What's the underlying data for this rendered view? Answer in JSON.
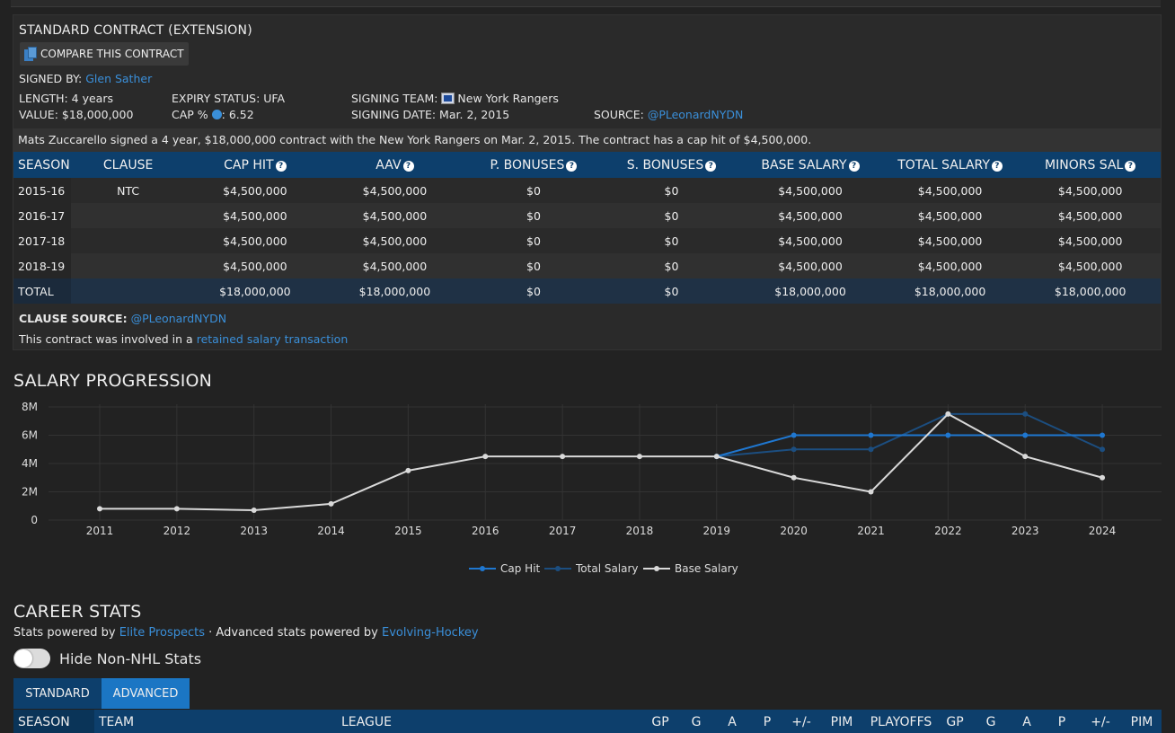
{
  "contract": {
    "title": "STANDARD CONTRACT (EXTENSION)",
    "compare_label": "COMPARE THIS CONTRACT",
    "signed_by_label": "SIGNED BY:",
    "signed_by": "Glen Sather",
    "length": "LENGTH: 4 years",
    "value": "VALUE: $18,000,000",
    "expiry_status": "EXPIRY STATUS: UFA",
    "cap_pct_label": "CAP %",
    "cap_pct_value": ": 6.52",
    "signing_team_label": "SIGNING TEAM:",
    "signing_team": "New York Rangers",
    "signing_date": "SIGNING DATE: Mar. 2, 2015",
    "source_label": "SOURCE:",
    "source": "@PLeonardNYDN",
    "summary": "Mats Zuccarello signed a 4 year, $18,000,000 contract with the New York Rangers on Mar. 2, 2015. The contract has a cap hit of $4,500,000.",
    "headers": [
      "SEASON",
      "CLAUSE",
      "CAP HIT",
      "AAV",
      "P. BONUSES",
      "S. BONUSES",
      "BASE SALARY",
      "TOTAL SALARY",
      "MINORS SAL"
    ],
    "rows": [
      [
        "2015-16",
        "NTC",
        "$4,500,000",
        "$4,500,000",
        "$0",
        "$0",
        "$4,500,000",
        "$4,500,000",
        "$4,500,000"
      ],
      [
        "2016-17",
        "",
        "$4,500,000",
        "$4,500,000",
        "$0",
        "$0",
        "$4,500,000",
        "$4,500,000",
        "$4,500,000"
      ],
      [
        "2017-18",
        "",
        "$4,500,000",
        "$4,500,000",
        "$0",
        "$0",
        "$4,500,000",
        "$4,500,000",
        "$4,500,000"
      ],
      [
        "2018-19",
        "",
        "$4,500,000",
        "$4,500,000",
        "$0",
        "$0",
        "$4,500,000",
        "$4,500,000",
        "$4,500,000"
      ]
    ],
    "total": [
      "TOTAL",
      "",
      "$18,000,000",
      "$18,000,000",
      "$0",
      "$0",
      "$18,000,000",
      "$18,000,000",
      "$18,000,000"
    ],
    "clause_source_label": "CLAUSE SOURCE:",
    "clause_source": "@PLeonardNYDN",
    "retained_text": "This contract was involved in a",
    "retained_link": "retained salary transaction"
  },
  "salary_section_title": "SALARY PROGRESSION",
  "chart_data": {
    "type": "line",
    "x": [
      "2011",
      "2012",
      "2013",
      "2014",
      "2015",
      "2016",
      "2017",
      "2018",
      "2019",
      "2020",
      "2021",
      "2022",
      "2023",
      "2024"
    ],
    "y_ticks": [
      "0",
      "2M",
      "4M",
      "6M",
      "8M"
    ],
    "ylim": [
      0,
      8000000
    ],
    "grid": true,
    "legend_position": "bottom",
    "series": [
      {
        "name": "Cap Hit",
        "color": "#1f77d0",
        "x_start": "2019",
        "values": [
          4500000,
          6000000,
          6000000,
          6000000,
          6000000,
          6000000
        ]
      },
      {
        "name": "Total Salary",
        "color": "#1c4e80",
        "x_start": "2019",
        "values": [
          4500000,
          5000000,
          5000000,
          7500000,
          7500000,
          5000000
        ]
      },
      {
        "name": "Base Salary",
        "color": "#d9d9d9",
        "x_start": "2011",
        "values": [
          800000,
          800000,
          700000,
          1150000,
          3500000,
          4500000,
          4500000,
          4500000,
          4500000,
          3000000,
          2000000,
          7500000,
          4500000,
          3000000
        ]
      }
    ]
  },
  "career": {
    "title": "CAREER STATS",
    "powered_prefix": "Stats powered by",
    "elite_link": "Elite Prospects",
    "powered_mid": "· Advanced stats powered by",
    "evolving_link": "Evolving-Hockey",
    "toggle_label": "Hide Non-NHL Stats",
    "tab_standard": "STANDARD",
    "tab_advanced": "ADVANCED",
    "stats_headers": [
      "SEASON",
      "TEAM",
      "LEAGUE",
      "GP",
      "G",
      "A",
      "P",
      "+/-",
      "PIM",
      "PLAYOFFS",
      "GP",
      "G",
      "A",
      "P",
      "+/-",
      "PIM"
    ]
  }
}
